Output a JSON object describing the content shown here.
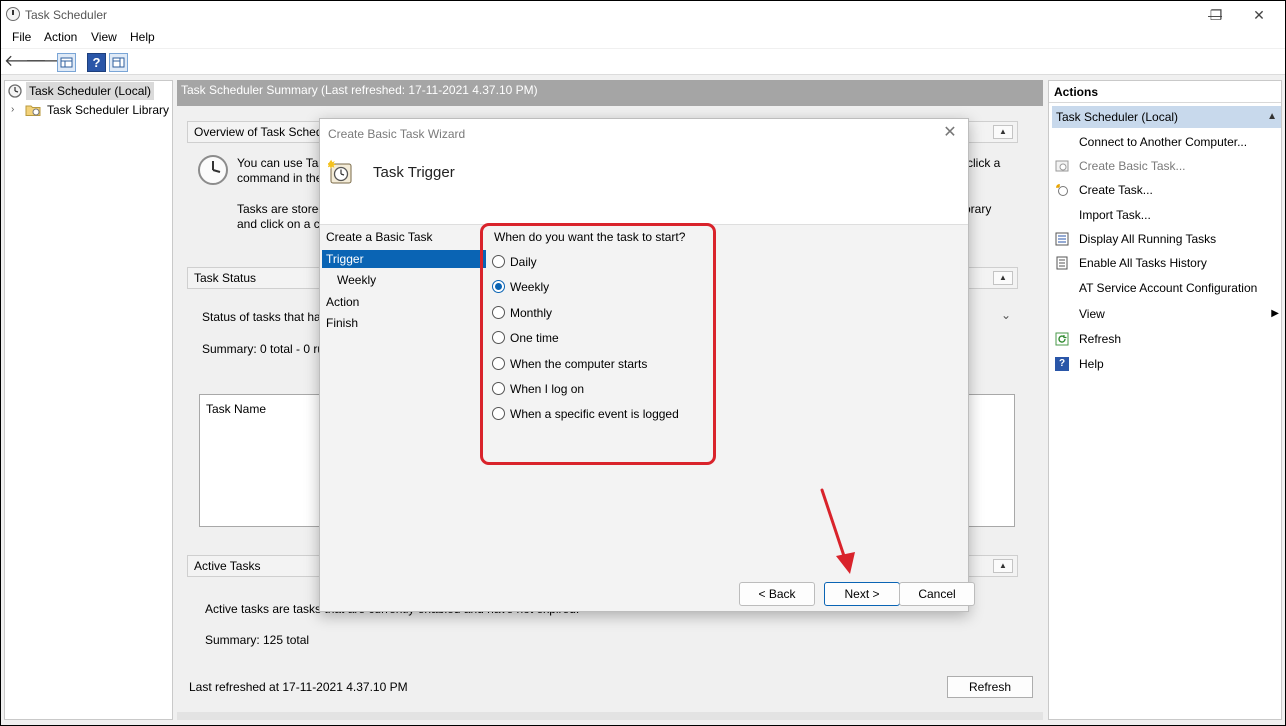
{
  "window": {
    "title": "Task Scheduler",
    "controls": {
      "minimize": "—",
      "maximize": "❐",
      "close": "✕"
    }
  },
  "menu": [
    "File",
    "Action",
    "View",
    "Help"
  ],
  "toolbar": {
    "back_icon": "back-arrow-icon",
    "forward_icon": "forward-arrow-icon",
    "help_label": "?"
  },
  "tree": {
    "items": [
      {
        "label": "Task Scheduler (Local)",
        "selected": true
      },
      {
        "label": "Task Scheduler Library",
        "selected": false
      }
    ]
  },
  "center": {
    "header": "Task Scheduler Summary (Last refreshed: 17-11-2021 4.37.10 PM)",
    "overview": {
      "title": "Overview of Task Scheduler",
      "line1_left": "You can use Task",
      "line1_right": "click a",
      "line2_left": "command in the",
      "line3_left": "Tasks are stored i",
      "line3_right": "orary",
      "line4_left": "and click on a co"
    },
    "task_status": {
      "title": "Task Status",
      "status_text": "Status of tasks that have",
      "summary": "Summary: 0 total - 0 ru",
      "column": "Task Name"
    },
    "active_tasks": {
      "title": "Active Tasks",
      "description": "Active tasks are tasks that are currently enabled and have not expired.",
      "summary": "Summary: 125 total"
    },
    "last_refreshed": "Last refreshed at 17-11-2021 4.37.10 PM",
    "refresh_button": "Refresh"
  },
  "actions": {
    "title": "Actions",
    "section": "Task Scheduler (Local)",
    "items": [
      {
        "label": "Connect to Another Computer...",
        "icon": "none",
        "disabled": false
      },
      {
        "label": "Create Basic Task...",
        "icon": "create-basic-task-icon",
        "disabled": true
      },
      {
        "label": "Create Task...",
        "icon": "create-task-icon",
        "disabled": false
      },
      {
        "label": "Import Task...",
        "icon": "none",
        "disabled": false
      },
      {
        "label": "Display All Running Tasks",
        "icon": "running-tasks-icon",
        "disabled": false
      },
      {
        "label": "Enable All Tasks History",
        "icon": "history-icon",
        "disabled": false
      },
      {
        "label": "AT Service Account Configuration",
        "icon": "none",
        "disabled": false
      },
      {
        "label": "View",
        "icon": "none",
        "disabled": false,
        "submenu": true
      },
      {
        "label": "Refresh",
        "icon": "refresh-icon",
        "disabled": false
      },
      {
        "label": "Help",
        "icon": "help-icon",
        "disabled": false
      }
    ]
  },
  "dialog": {
    "title": "Create Basic Task Wizard",
    "close": "✕",
    "heading": "Task Trigger",
    "steps": [
      {
        "label": "Create a Basic Task",
        "active": false,
        "indent": false
      },
      {
        "label": "Trigger",
        "active": true,
        "indent": false
      },
      {
        "label": "Weekly",
        "active": false,
        "indent": true
      },
      {
        "label": "Action",
        "active": false,
        "indent": false
      },
      {
        "label": "Finish",
        "active": false,
        "indent": false
      }
    ],
    "question": "When do you want the task to start?",
    "options": [
      {
        "label": "Daily",
        "checked": false
      },
      {
        "label": "Weekly",
        "checked": true
      },
      {
        "label": "Monthly",
        "checked": false
      },
      {
        "label": "One time",
        "checked": false
      },
      {
        "label": "When the computer starts",
        "checked": false
      },
      {
        "label": "When I log on",
        "checked": false
      },
      {
        "label": "When a specific event is logged",
        "checked": false
      }
    ],
    "buttons": {
      "back": "< Back",
      "next": "Next >",
      "cancel": "Cancel"
    }
  },
  "annotation_color": "#d9232b",
  "accent_color": "#0a64b4"
}
